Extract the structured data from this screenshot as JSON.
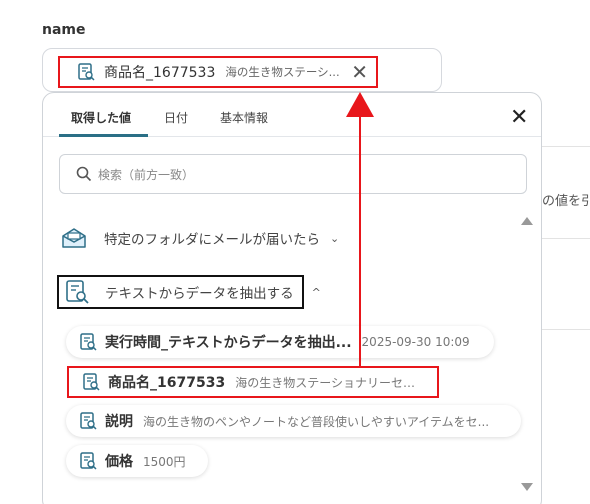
{
  "field": {
    "label": "name"
  },
  "selected_chip": {
    "name": "商品名_1677533",
    "value": "海の生き物ステーシ...",
    "remove_symbol": "✕"
  },
  "background": {
    "text": "の値を引"
  },
  "picker": {
    "tabs": [
      {
        "label": "取得した値"
      },
      {
        "label": "日付"
      },
      {
        "label": "基本情報"
      }
    ],
    "close_symbol": "✕",
    "search": {
      "placeholder": "検索（前方一致）"
    },
    "groups": [
      {
        "label": "特定のフォルダにメールが届いたら",
        "chevron": "⌄"
      },
      {
        "label": "テキストからデータを抽出する",
        "chevron": "^"
      }
    ],
    "items": [
      {
        "name": "実行時間_テキストからデータを抽出...",
        "value": "2025-09-30 10:09"
      },
      {
        "name": "商品名_1677533",
        "value": "海の生き物ステーショナリーセット"
      },
      {
        "name": "説明",
        "value": "海の生き物のペンやノートなど普段使いしやすいアイテムをセ..."
      },
      {
        "name": "価格",
        "value": "1500円"
      }
    ]
  },
  "colors": {
    "highlight": "#e8161b",
    "tab_accent": "#2a6f86",
    "icon": "#2f6f88"
  }
}
